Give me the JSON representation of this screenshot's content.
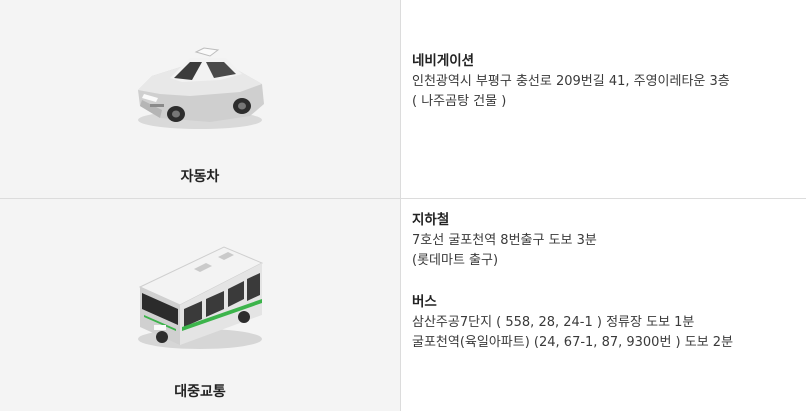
{
  "car": {
    "label": "자동차",
    "icon": "car-icon",
    "sections": [
      {
        "title": "네비게이션",
        "lines": [
          "인천광역시 부평구 충선로 209번길 41, 주영이레타운 3층",
          "( 나주곰탕 건물 )"
        ]
      }
    ]
  },
  "transit": {
    "label": "대중교통",
    "icon": "bus-icon",
    "sections": [
      {
        "title": "지하철",
        "lines": [
          "7호선 굴포천역 8번출구 도보 3분",
          "(롯데마트 출구)"
        ]
      },
      {
        "title": "버스",
        "lines": [
          "삼산주공7단지 ( 558, 28, 24-1 ) 정류장 도보 1분",
          "굴포천역(육일아파트) (24, 67-1, 87, 9300번 ) 도보 2분"
        ]
      }
    ]
  },
  "colors": {
    "cell_bg": "#f4f4f4",
    "border": "#dcdcdc",
    "bus_accent": "#3cb44b"
  }
}
